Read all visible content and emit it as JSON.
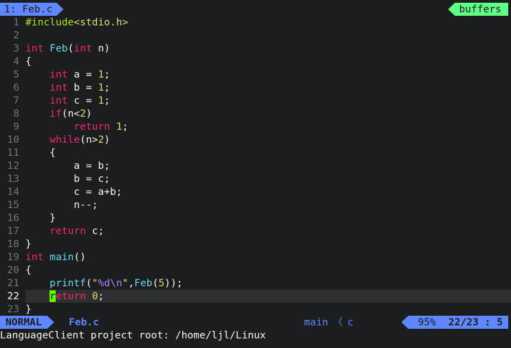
{
  "tabline": {
    "active_tab": "1: Feb.c",
    "buffers_label": "buffers"
  },
  "lines": [
    {
      "n": "1",
      "code": "#include<stdio.h>"
    },
    {
      "n": "2",
      "code": ""
    },
    {
      "n": "3",
      "code": "int Feb(int n)"
    },
    {
      "n": "4",
      "code": "{"
    },
    {
      "n": "5",
      "code": "    int a = 1;"
    },
    {
      "n": "6",
      "code": "    int b = 1;"
    },
    {
      "n": "7",
      "code": "    int c = 1;"
    },
    {
      "n": "8",
      "code": "    if(n<2)"
    },
    {
      "n": "9",
      "code": "        return 1;"
    },
    {
      "n": "10",
      "code": "    while(n>2)"
    },
    {
      "n": "11",
      "code": "    {"
    },
    {
      "n": "12",
      "code": "        a = b;"
    },
    {
      "n": "13",
      "code": "        b = c;"
    },
    {
      "n": "14",
      "code": "        c = a+b;"
    },
    {
      "n": "15",
      "code": "        n--;"
    },
    {
      "n": "16",
      "code": "    }"
    },
    {
      "n": "17",
      "code": "    return c;"
    },
    {
      "n": "18",
      "code": "}"
    },
    {
      "n": "19",
      "code": "int main()"
    },
    {
      "n": "20",
      "code": "{"
    },
    {
      "n": "21",
      "code": "    printf(\"%d\\n\",Feb(5));"
    },
    {
      "n": "22",
      "code": "    return 0;"
    },
    {
      "n": "23",
      "code": "}"
    }
  ],
  "statusline": {
    "mode": "NORMAL",
    "filename": "Feb.c",
    "function": "main",
    "separator": "〈",
    "filetype": "c",
    "percent": "95%",
    "position": "22/23 :  5"
  },
  "cmdline": "LanguageClient project root: /home/ljl/Linux",
  "colors": {
    "background": "#1b1d1e",
    "accent_blue": "#5f87ff",
    "accent_green": "#5fff87",
    "keyword": "#f92672",
    "function": "#66d9ef",
    "number": "#e6db74",
    "preprocessor": "#a6e22e"
  }
}
